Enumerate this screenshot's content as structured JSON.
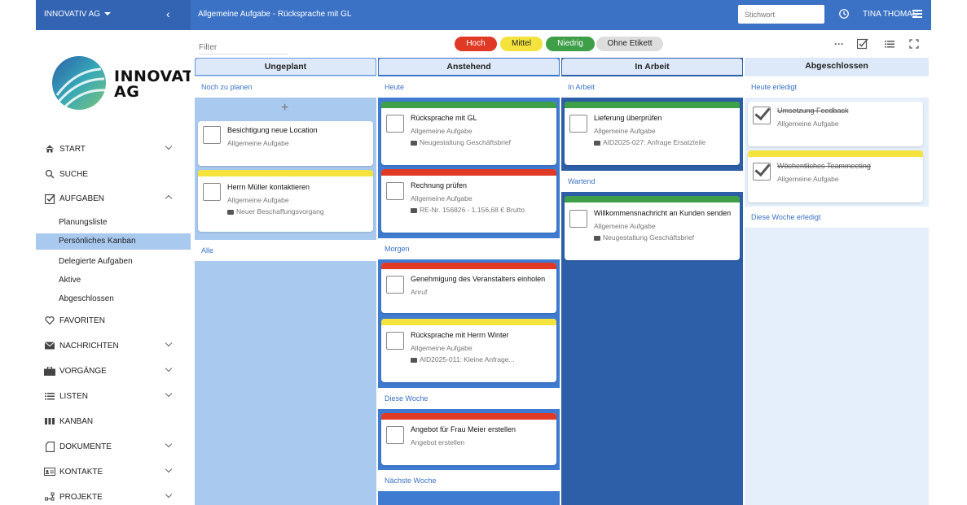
{
  "topbar": {
    "company": "INNOVATIV AG",
    "breadcrumb": "Allgemeine Aufgabe - Rücksprache mit GL",
    "search_placeholder": "Stichwort",
    "user": "TINA THOMAS"
  },
  "sidebar": {
    "logo_line1": "INNOVATIV",
    "logo_line2": "AG",
    "items": [
      {
        "label": "START",
        "icon": "home-icon"
      },
      {
        "label": "SUCHE",
        "icon": "search-icon"
      },
      {
        "label": "AUFGABEN",
        "icon": "checkbox-icon"
      },
      {
        "label": "FAVORITEN",
        "icon": "heart-icon"
      },
      {
        "label": "NACHRICHTEN",
        "icon": "mail-icon"
      },
      {
        "label": "VORGÄNGE",
        "icon": "briefcase-icon"
      },
      {
        "label": "LISTEN",
        "icon": "list-icon"
      },
      {
        "label": "KANBAN",
        "icon": "kanban-icon"
      },
      {
        "label": "DOKUMENTE",
        "icon": "document-icon"
      },
      {
        "label": "KONTAKTE",
        "icon": "contact-icon"
      },
      {
        "label": "PROJEKTE",
        "icon": "project-icon"
      }
    ],
    "sub_items": [
      {
        "label": "Planungsliste"
      },
      {
        "label": "Persönliches Kanban"
      },
      {
        "label": "Delegierte Aufgaben"
      },
      {
        "label": "Aktive"
      },
      {
        "label": "Abgeschlossen"
      }
    ]
  },
  "board": {
    "filter_placeholder": "Filter",
    "tags": [
      {
        "label": "Hoch",
        "color": "#e03a26"
      },
      {
        "label": "Mittel",
        "color": "#f4e33c"
      },
      {
        "label": "Niedrig",
        "color": "#3f9e48"
      },
      {
        "label": "Ohne Etikett",
        "color": "#dddddd"
      }
    ],
    "columns": [
      {
        "title": "Ungeplant",
        "sections": [
          "Noch zu planen",
          "Alle"
        ],
        "cards": [
          {
            "title": "Besichtigung neue Location",
            "sub": "Allgemeine Aufgabe"
          },
          {
            "title": "Herrn Müller kontaktieren",
            "sub": "Allgemeine Aufgabe",
            "meta": "Neuer Beschaffungsvorgang"
          }
        ]
      },
      {
        "title": "Anstehend",
        "sections": [
          "Heute",
          "Morgen",
          "Diese Woche",
          "Nächste Woche"
        ],
        "cards": [
          {
            "title": "Rücksprache mit GL",
            "sub": "Allgemeine Aufgabe",
            "meta": "Neugestaltung Geschäftsbrief"
          },
          {
            "title": "Rechnung prüfen",
            "sub": "Allgemeine Aufgabe",
            "meta": "RE-Nr. 156826 - 1.156,68 € Brutto"
          },
          {
            "title": "Genehmigung des Veranstalters einholen",
            "sub": "Anruf"
          },
          {
            "title": "Rücksprache mit Herrn Winter",
            "sub": "Allgemeine Aufgabe",
            "meta": "AID2025-011: Kleine Anfrage..."
          },
          {
            "title": "Angebot für Frau Meier erstellen",
            "sub": "Angebot erstellen"
          }
        ]
      },
      {
        "title": "In Arbeit",
        "sections": [
          "In Arbeit",
          "Wartend"
        ],
        "cards": [
          {
            "title": "Lieferung überprüfen",
            "sub": "Allgemeine Aufgabe",
            "meta": "AID2025-027: Anfrage Ersatzteile"
          },
          {
            "title": "Willkommensnachricht an Kunden senden",
            "sub": "Allgemeine Aufgabe",
            "meta": "Neugestaltung Geschäftsbrief"
          }
        ]
      },
      {
        "title": "Abgeschlossen",
        "sections": [
          "Heute erledigt",
          "Diese Woche erledigt"
        ],
        "cards": [
          {
            "title": "Umsetzung Feedback",
            "sub": "Allgemeine Aufgabe"
          },
          {
            "title": "Wöchentliches Teammeeting",
            "sub": "Allgemeine Aufgabe"
          }
        ]
      }
    ]
  }
}
